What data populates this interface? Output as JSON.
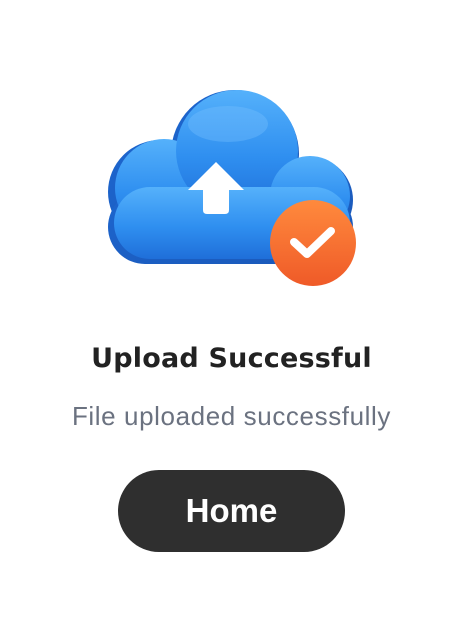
{
  "dialog": {
    "illustration_icons": [
      "cloud-upload-icon",
      "check-badge-icon"
    ],
    "title": "Upload Successful",
    "subtitle": "File uploaded successfully",
    "home_button_label": "Home"
  },
  "colors": {
    "cloud_blue": "#2f8ff0",
    "check_badge_orange": "#f36a2f",
    "button_dark": "#2f2f2f",
    "title_text": "#222222",
    "subtitle_text": "#6b7280"
  }
}
